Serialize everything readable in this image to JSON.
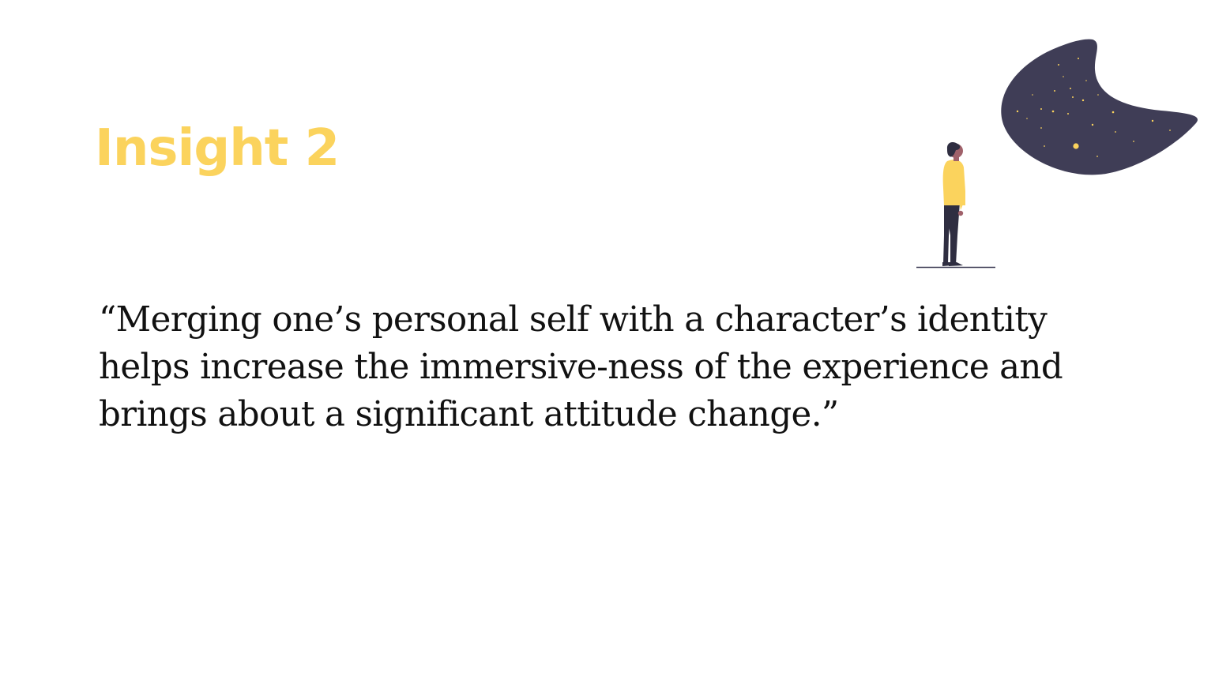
{
  "slide": {
    "title": "Insight 2",
    "quote_lines": [
      "“Merging one’s personal self with a character’s identity",
      "helps increase the immersive-ness of the experience and",
      "brings about a significant attitude change.”"
    ]
  },
  "illustration": {
    "icon": "person-looking-at-night-sky-icon"
  },
  "colors": {
    "accent": "#FBD35D",
    "night_sky": "#3F3D56",
    "star": "#FBD35D",
    "text": "#111111",
    "background": "#FFFFFF"
  }
}
